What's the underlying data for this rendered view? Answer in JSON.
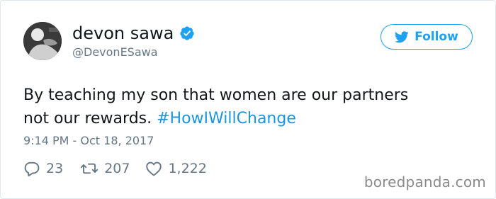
{
  "tweet": {
    "author": {
      "display_name": "devon sawa",
      "handle": "@DevonESawa",
      "verified": true,
      "avatar_icon": "profile-photo"
    },
    "follow_button": {
      "label": "Follow",
      "icon": "twitter-bird-icon",
      "color": "#1da1f2"
    },
    "text": {
      "body_line1": "By teaching my son that women are our partners",
      "body_line2": "not our rewards. ",
      "hashtag": "#HowIWillChange",
      "hashtag_color": "#1b95e0"
    },
    "timestamp": "9:14 PM - Oct 18, 2017",
    "actions": {
      "replies": "23",
      "retweets": "207",
      "likes": "1,222",
      "reply_icon": "reply-bubble-icon",
      "retweet_icon": "retweet-icon",
      "like_icon": "heart-icon"
    }
  },
  "watermark": "boredpanda.com"
}
